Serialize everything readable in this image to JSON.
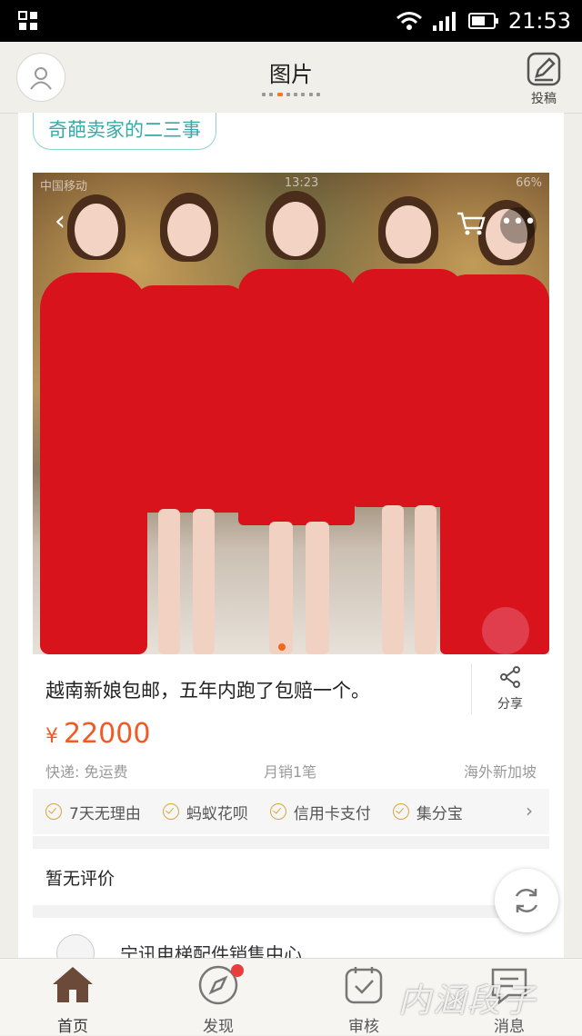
{
  "status_bar": {
    "time": "21:53"
  },
  "header": {
    "title": "图片",
    "submit_label": "投稿"
  },
  "post": {
    "tag": "奇葩卖家的二三事",
    "screenshot_status": {
      "carrier": "中国移动",
      "time": "13:23",
      "battery": "66%"
    },
    "product_title": "越南新娘包邮，五年内跑了包赔一个。",
    "share_label": "分享",
    "price_currency": "¥",
    "price_value": "22000",
    "shipping": "快递: 免运费",
    "monthly_sales": "月销1笔",
    "location": "海外新加坡",
    "services": [
      "7天无理由",
      "蚂蚁花呗",
      "信用卡支付",
      "集分宝"
    ],
    "reviews_label": "暂无评价",
    "seller_name": "宁讯电梯配件销售中心"
  },
  "tabs": [
    {
      "label": "首页",
      "icon": "home-icon"
    },
    {
      "label": "发现",
      "icon": "compass-icon"
    },
    {
      "label": "审核",
      "icon": "review-icon"
    },
    {
      "label": "消息",
      "icon": "message-icon"
    }
  ],
  "watermark": "内涵段子",
  "colors": {
    "accent": "#f15a24",
    "tag": "#3aa8a7",
    "badge": "#e93c3c"
  }
}
